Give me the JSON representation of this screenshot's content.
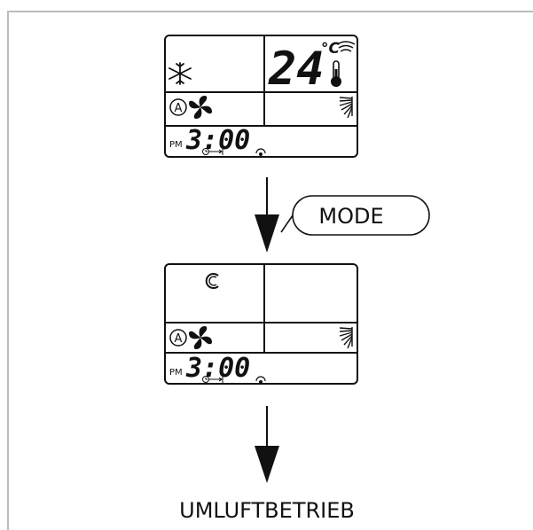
{
  "panel_before": {
    "temperature": "24",
    "temperature_unit": "°C",
    "auto_label": "A",
    "time_period": "PM",
    "time": "3:00",
    "icons": [
      "snowflake-icon",
      "fan-icon",
      "thermometer-icon",
      "signal-icon",
      "swing-icon",
      "timer-icon",
      "sensor-dot-icon"
    ]
  },
  "mode_button": {
    "label": "MODE"
  },
  "panel_after": {
    "auto_label": "A",
    "time_period": "PM",
    "time": "3:00",
    "icons": [
      "recirculation-icon",
      "fan-icon",
      "swing-icon",
      "timer-icon",
      "sensor-dot-icon"
    ]
  },
  "result": {
    "label": "UMLUFTBETRIEB"
  },
  "colors": {
    "frame": "#bdbdbd",
    "ink": "#111111"
  }
}
